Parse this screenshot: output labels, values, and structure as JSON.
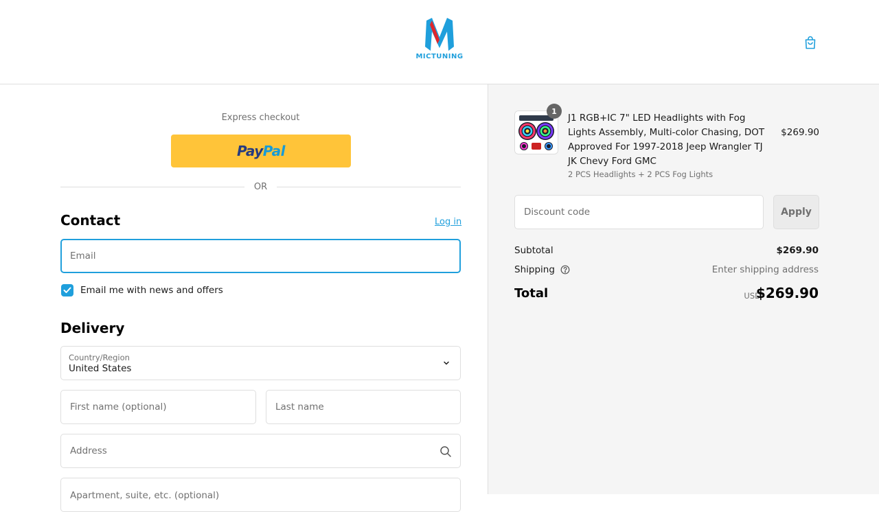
{
  "header": {
    "logo_text": "MICTUNING",
    "brand_color": "#1f9fdc",
    "cart_icon": "shopping-bag-icon"
  },
  "express": {
    "label": "Express checkout",
    "paypal_pay": "Pay",
    "paypal_pal": "Pal",
    "or_text": "OR"
  },
  "contact": {
    "title": "Contact",
    "login_link": "Log in",
    "email_placeholder": "Email",
    "newsletter_label": "Email me with news and offers",
    "newsletter_checked": true
  },
  "delivery": {
    "title": "Delivery",
    "country_label": "Country/Region",
    "country_value": "United States",
    "first_name_placeholder": "First name (optional)",
    "last_name_placeholder": "Last name",
    "address_placeholder": "Address",
    "apartment_placeholder": "Apartment, suite, etc. (optional)"
  },
  "order": {
    "product": {
      "quantity": "1",
      "title": "J1 RGB+IC 7\" LED Headlights with Fog Lights Assembly, Multi-color Chasing, DOT Approved For 1997-2018 Jeep Wrangler TJ JK Chevy Ford GMC",
      "variant": "2 PCS Headlights + 2 PCS Fog Lights",
      "price": "$269.90"
    },
    "discount_placeholder": "Discount code",
    "apply_label": "Apply",
    "subtotal_label": "Subtotal",
    "subtotal_value": "$269.90",
    "shipping_label": "Shipping",
    "shipping_value": "Enter shipping address",
    "total_label": "Total",
    "currency": "USD",
    "total_value": "$269.90"
  }
}
